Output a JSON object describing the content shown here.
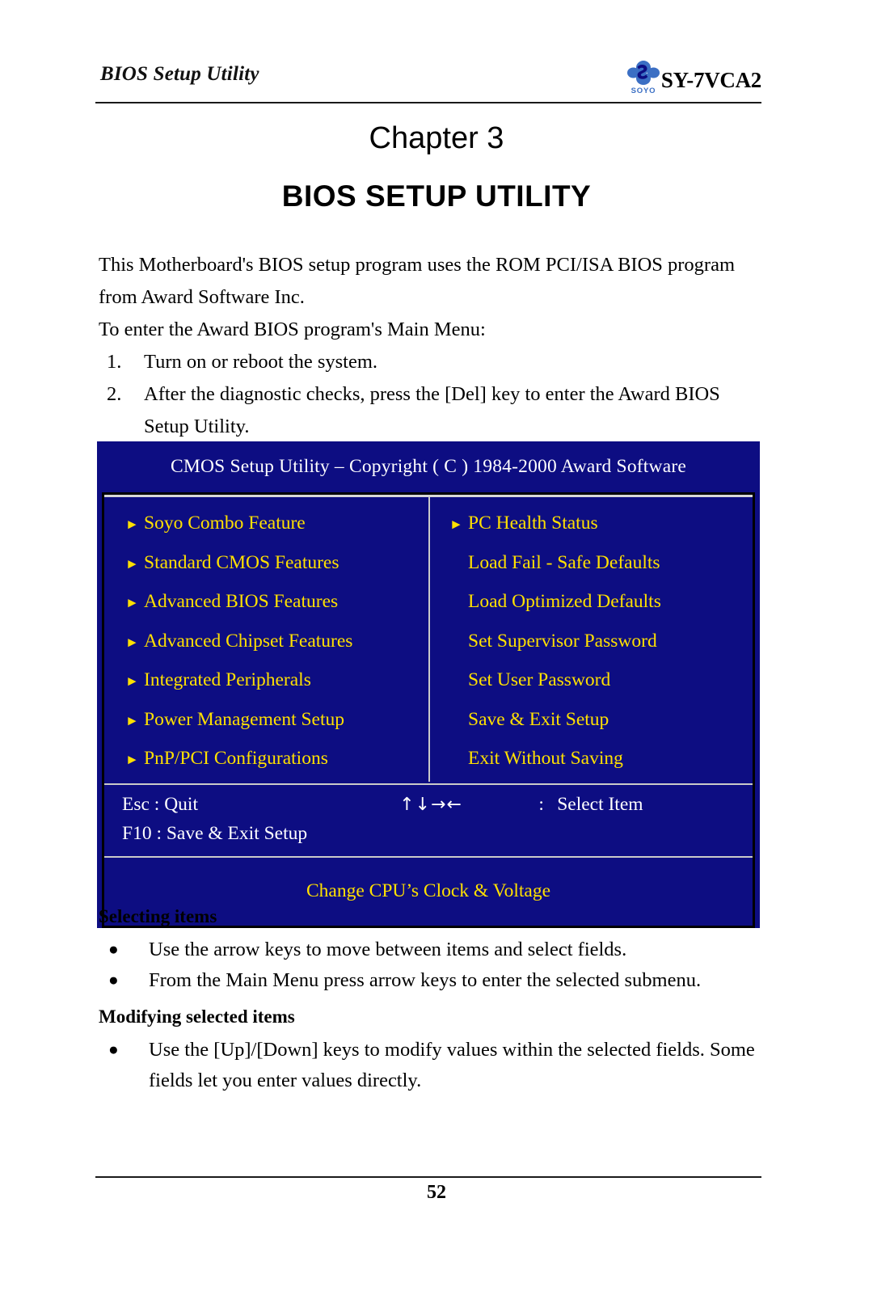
{
  "header": {
    "running_title": "BIOS Setup Utility",
    "logo_text": "SOYO",
    "board_model": "SY-7VCA2"
  },
  "headings": {
    "chapter": "Chapter  3",
    "title": "BIOS SETUP UTILITY"
  },
  "intro": {
    "paragraph_1": "This Motherboard's BIOS setup program uses the ROM PCI/ISA BIOS program from Award Software Inc.",
    "paragraph_2": "To enter the Award BIOS program's Main Menu:",
    "steps": [
      {
        "num": "1.",
        "text": "Turn on or reboot the system."
      },
      {
        "num": "2.",
        "text": "After the diagnostic checks, press the [Del] key to enter the Award BIOS Setup Utility."
      }
    ]
  },
  "bios": {
    "titlebar": "CMOS Setup Utility – Copyright ( C ) 1984-2000 Award Software",
    "left_column": [
      {
        "label": "Soyo Combo Feature",
        "arrow": true
      },
      {
        "label": "Standard CMOS Features",
        "arrow": true
      },
      {
        "label": "Advanced BIOS Features",
        "arrow": true
      },
      {
        "label": "Advanced Chipset Features",
        "arrow": true
      },
      {
        "label": "Integrated Peripherals",
        "arrow": true
      },
      {
        "label": "Power Management Setup",
        "arrow": true
      },
      {
        "label": "PnP/PCI Configurations",
        "arrow": true
      }
    ],
    "right_column": [
      {
        "label": "PC Health Status",
        "arrow": true
      },
      {
        "label": "Load Fail - Safe Defaults",
        "arrow": false
      },
      {
        "label": "Load Optimized Defaults",
        "arrow": false
      },
      {
        "label": "Set Supervisor Password",
        "arrow": false
      },
      {
        "label": "Set User Password",
        "arrow": false
      },
      {
        "label": "Save & Exit Setup",
        "arrow": false
      },
      {
        "label": "Exit Without Saving",
        "arrow": false
      }
    ],
    "footer": {
      "quit_key": "Esc : Quit",
      "arrow_keys": "↑↓→←",
      "colon": ":",
      "select_action": "Select Item",
      "save_key": "F10 : Save & Exit Setup"
    },
    "help_text": "Change CPU’s Clock & Voltage",
    "colors": {
      "background": "#0d0d82",
      "item_text": "#ffe000",
      "footer_text": "#ffffff",
      "divider": "#c9c9c9"
    }
  },
  "instructions": {
    "selecting_heading": "Selecting items",
    "selecting_bullets": [
      "Use the arrow keys to move between items and select fields.",
      "From the Main Menu press arrow keys to enter the selected submenu."
    ],
    "modifying_heading": "Modifying selected items",
    "modifying_bullets": [
      "Use the [Up]/[Down] keys to modify values within the selected fields. Some fields let you enter values directly."
    ],
    "bullet_glyph": "●"
  },
  "footer": {
    "page_number": "52"
  }
}
